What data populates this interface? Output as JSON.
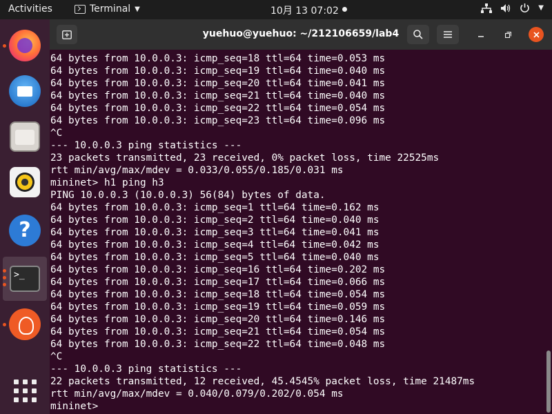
{
  "topbar": {
    "activities": "Activities",
    "app_menu": "Terminal",
    "clock": "10月 13  07:02"
  },
  "dock": {
    "items": [
      {
        "name": "firefox-icon",
        "running": true
      },
      {
        "name": "thunderbird-icon",
        "running": false
      },
      {
        "name": "files-icon",
        "running": false
      },
      {
        "name": "rhythmbox-icon",
        "running": false
      },
      {
        "name": "help-icon",
        "running": false
      },
      {
        "name": "terminal-icon",
        "running": true
      },
      {
        "name": "postman-icon",
        "running": true
      },
      {
        "name": "show-apps-icon",
        "running": false
      }
    ],
    "terminal_glyph": ">_",
    "help_glyph": "?"
  },
  "window": {
    "title": "yuehuo@yuehuo: ~/212106659/lab4"
  },
  "terminal": {
    "lines": [
      "64 bytes from 10.0.0.3: icmp_seq=18 ttl=64 time=0.053 ms",
      "64 bytes from 10.0.0.3: icmp_seq=19 ttl=64 time=0.040 ms",
      "64 bytes from 10.0.0.3: icmp_seq=20 ttl=64 time=0.041 ms",
      "64 bytes from 10.0.0.3: icmp_seq=21 ttl=64 time=0.040 ms",
      "64 bytes from 10.0.0.3: icmp_seq=22 ttl=64 time=0.054 ms",
      "64 bytes from 10.0.0.3: icmp_seq=23 ttl=64 time=0.096 ms",
      "^C",
      "--- 10.0.0.3 ping statistics ---",
      "23 packets transmitted, 23 received, 0% packet loss, time 22525ms",
      "rtt min/avg/max/mdev = 0.033/0.055/0.185/0.031 ms",
      "mininet> h1 ping h3",
      "PING 10.0.0.3 (10.0.0.3) 56(84) bytes of data.",
      "64 bytes from 10.0.0.3: icmp_seq=1 ttl=64 time=0.162 ms",
      "64 bytes from 10.0.0.3: icmp_seq=2 ttl=64 time=0.040 ms",
      "64 bytes from 10.0.0.3: icmp_seq=3 ttl=64 time=0.041 ms",
      "64 bytes from 10.0.0.3: icmp_seq=4 ttl=64 time=0.042 ms",
      "64 bytes from 10.0.0.3: icmp_seq=5 ttl=64 time=0.040 ms",
      "64 bytes from 10.0.0.3: icmp_seq=16 ttl=64 time=0.202 ms",
      "64 bytes from 10.0.0.3: icmp_seq=17 ttl=64 time=0.066 ms",
      "64 bytes from 10.0.0.3: icmp_seq=18 ttl=64 time=0.054 ms",
      "64 bytes from 10.0.0.3: icmp_seq=19 ttl=64 time=0.059 ms",
      "64 bytes from 10.0.0.3: icmp_seq=20 ttl=64 time=0.146 ms",
      "64 bytes from 10.0.0.3: icmp_seq=21 ttl=64 time=0.054 ms",
      "64 bytes from 10.0.0.3: icmp_seq=22 ttl=64 time=0.048 ms",
      "^C",
      "--- 10.0.0.3 ping statistics ---",
      "22 packets transmitted, 12 received, 45.4545% packet loss, time 21487ms",
      "rtt min/avg/max/mdev = 0.040/0.079/0.202/0.054 ms",
      "mininet> "
    ]
  },
  "colors": {
    "terminal_bg": "#300a24",
    "accent": "#e95420",
    "topbar_bg": "#1d1d1d"
  }
}
